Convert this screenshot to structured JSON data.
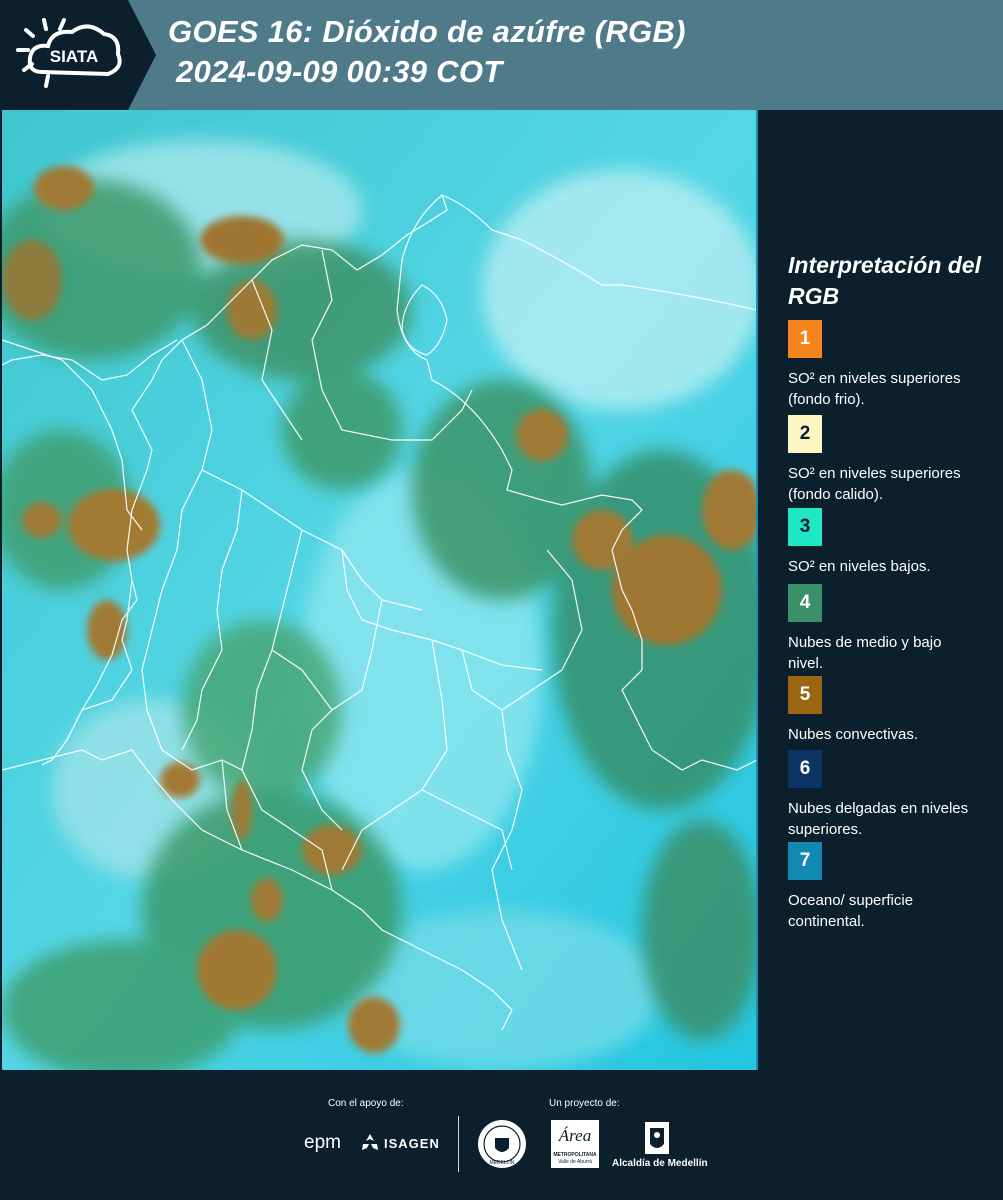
{
  "header": {
    "logo_text": "SIATA",
    "title_line1": "GOES 16: Dióxido de azúfre (RGB)",
    "title_line2": "2024-09-09 00:39 COT"
  },
  "colors": {
    "header_bg": "#4f7a8a",
    "panel_bg": "#0b1f2c",
    "ocean": "#2ec8e0",
    "clouds_low": "#3a9a6a",
    "convective": "#9a7a30"
  },
  "legend": {
    "title": "Interpretación del RGB",
    "items": [
      {
        "number": "1",
        "color": "#f7831c",
        "text": "SO² en niveles superiores (fondo frio)."
      },
      {
        "number": "2",
        "color": "#fdf6c3",
        "text": "SO² en niveles superiores (fondo calido)."
      },
      {
        "number": "3",
        "color": "#1fe6c4",
        "text": "SO² en niveles bajos."
      },
      {
        "number": "4",
        "color": "#3a8f68",
        "text": "Nubes de medio y bajo nivel."
      },
      {
        "number": "5",
        "color": "#9c6512",
        "text": "Nubes convectivas."
      },
      {
        "number": "6",
        "color": "#0c3566",
        "text": "Nubes delgadas en niveles superiores."
      },
      {
        "number": "7",
        "color": "#1289b3",
        "text": "Oceano/ superficie continental."
      }
    ]
  },
  "footer": {
    "support_label": "Con el apoyo de:",
    "project_label": "Un proyecto de:",
    "sponsor_epm": "epm",
    "sponsor_isagen": "ISAGEN",
    "seal_text": "MEDELLÍN",
    "area_script": "Área",
    "area_line1": "METROPOLITANA",
    "area_line2": "Valle de Aburrá",
    "alcaldia_text": "Alcaldía de Medellín"
  }
}
